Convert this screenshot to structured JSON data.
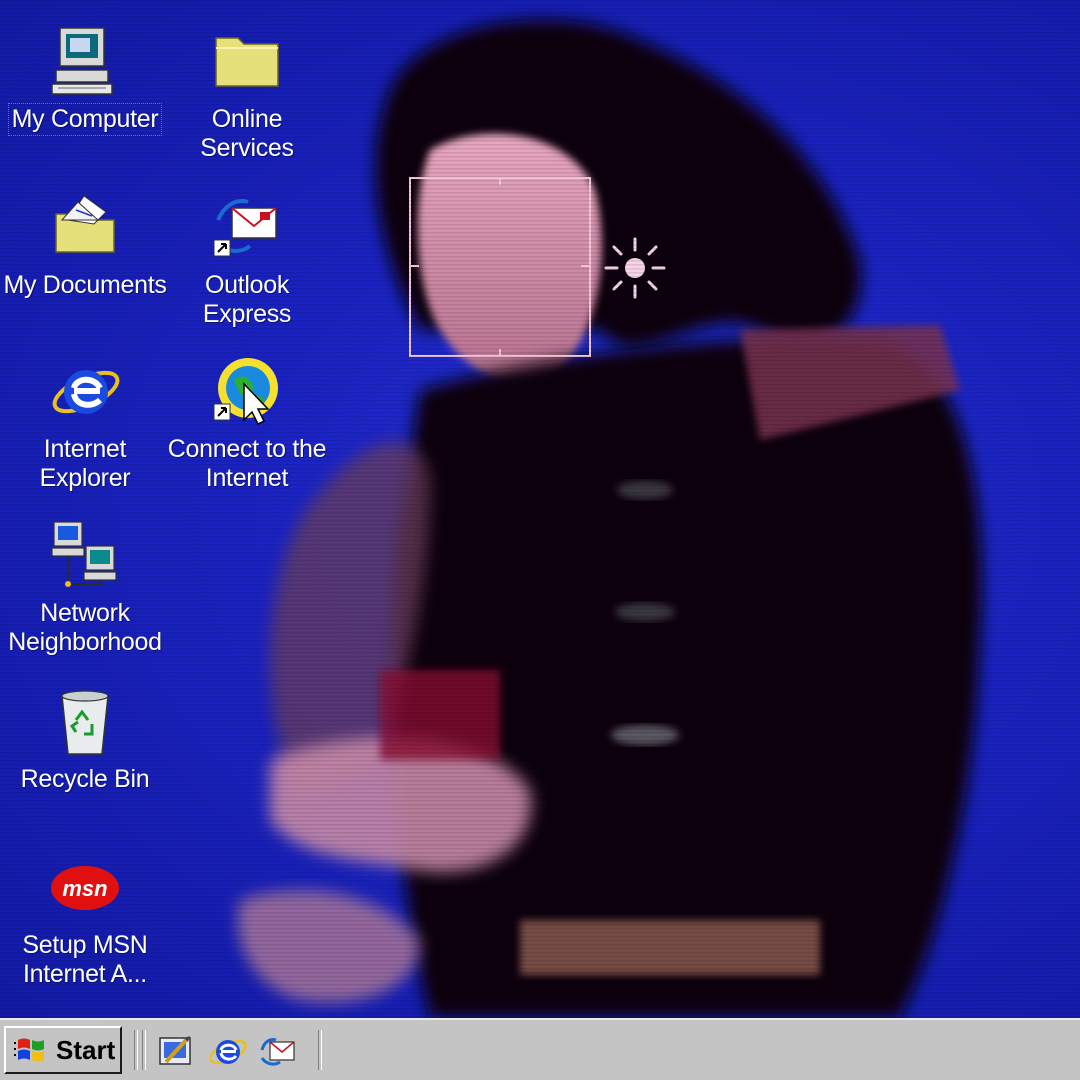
{
  "desktop": {
    "icons": [
      {
        "label": "My Computer",
        "icon": "my-computer-icon",
        "selected": true
      },
      {
        "label": "Online\nServices",
        "icon": "folder-icon"
      },
      {
        "label": "My Documents",
        "icon": "my-documents-icon"
      },
      {
        "label": "Outlook\nExpress",
        "icon": "outlook-express-icon"
      },
      {
        "label": "Internet\nExplorer",
        "icon": "internet-explorer-icon"
      },
      {
        "label": "Connect to the\nInternet",
        "icon": "connect-to-internet-icon"
      },
      {
        "label": "Network\nNeighborhood",
        "icon": "network-neighborhood-icon"
      },
      {
        "label": "Recycle Bin",
        "icon": "recycle-bin-icon"
      },
      {
        "label": "Setup MSN\nInternet A...",
        "icon": "msn-icon"
      }
    ]
  },
  "taskbar": {
    "start_label": "Start",
    "quick_launch": [
      "show-desktop-icon",
      "internet-explorer-icon",
      "outlook-express-icon"
    ]
  },
  "colors": {
    "desktop": "#1a22c4",
    "taskbar": "#c4c4c4",
    "frame": "#f3c6da"
  }
}
